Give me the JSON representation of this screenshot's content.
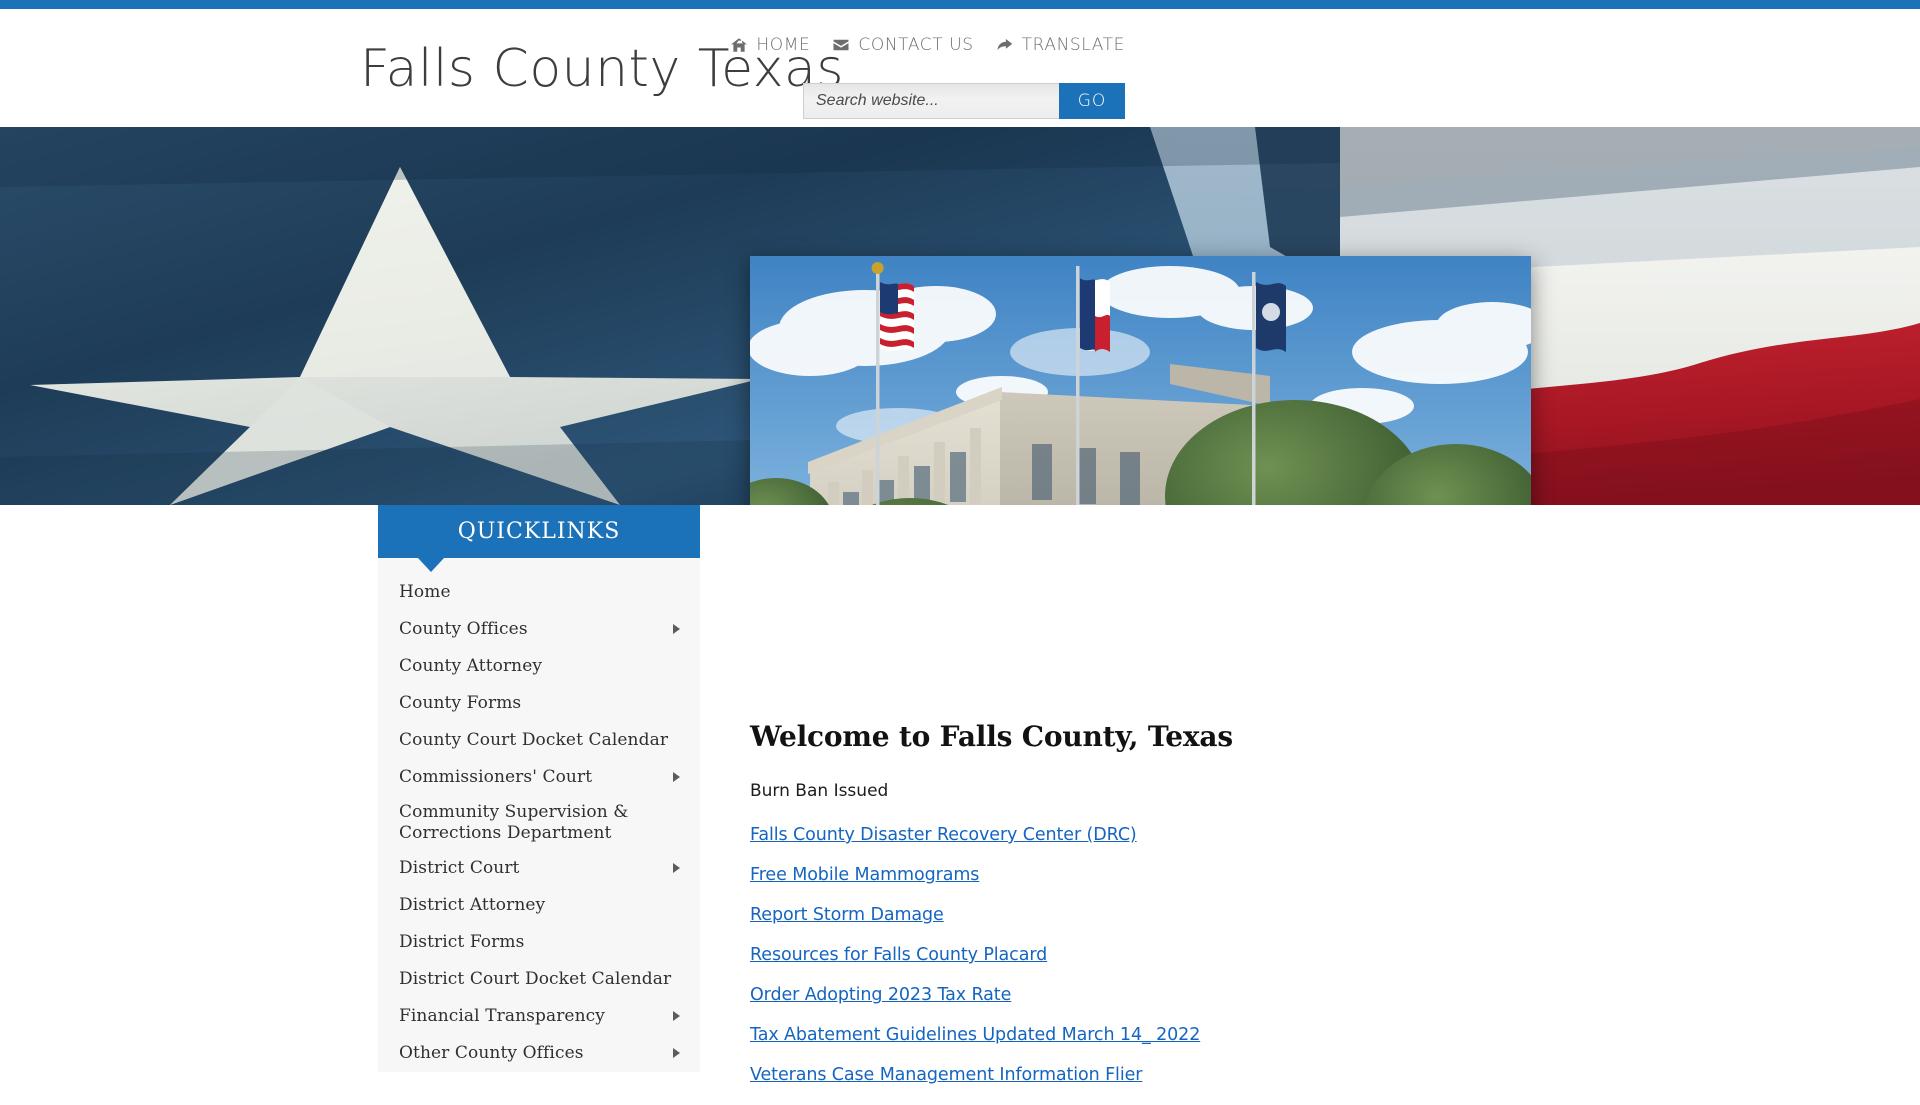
{
  "theme": {
    "accent": "#1b72b8",
    "link": "#1565c0",
    "sidebar_bg": "#f7f7f7",
    "title_color": "#3d3d3d"
  },
  "header": {
    "site_title": "Falls County Texas",
    "nav": [
      {
        "label": "HOME",
        "icon": "home-icon"
      },
      {
        "label": "CONTACT US",
        "icon": "envelope-icon"
      },
      {
        "label": "TRANSLATE",
        "icon": "share-arrow-icon"
      }
    ],
    "search": {
      "placeholder": "Search website...",
      "value": "",
      "button_label": "GO"
    }
  },
  "banner": {
    "alt": "Texas state flag close-up with white star on blue field and red and white stripes"
  },
  "hero": {
    "alt": "Falls County courthouse with United States, Texas and county flags in front of the building"
  },
  "sidebar": {
    "heading": "QUICKLINKS",
    "items": [
      {
        "label": "Home",
        "has_submenu": false
      },
      {
        "label": "County Offices",
        "has_submenu": true
      },
      {
        "label": "County Attorney",
        "has_submenu": false
      },
      {
        "label": "County Forms",
        "has_submenu": false
      },
      {
        "label": "County Court Docket Calendar",
        "has_submenu": false
      },
      {
        "label": "Commissioners' Court",
        "has_submenu": true
      },
      {
        "label": "Community Supervision & Corrections Department",
        "has_submenu": false
      },
      {
        "label": "District Court",
        "has_submenu": true
      },
      {
        "label": "District Attorney",
        "has_submenu": false
      },
      {
        "label": "District Forms",
        "has_submenu": false
      },
      {
        "label": "District Court Docket Calendar",
        "has_submenu": false
      },
      {
        "label": "Financial Transparency",
        "has_submenu": true
      },
      {
        "label": "Other County Offices",
        "has_submenu": true
      }
    ]
  },
  "main": {
    "title": "Welcome to Falls County, Texas",
    "note": "Burn Ban Issued",
    "links": [
      "Falls County Disaster Recovery Center (DRC)",
      "Free Mobile Mammograms",
      "Report Storm Damage",
      "Resources for Falls County Placard",
      "Order Adopting 2023 Tax Rate",
      "Tax Abatement Guidelines Updated March 14_ 2022",
      "Veterans Case Management Information Flier"
    ]
  }
}
